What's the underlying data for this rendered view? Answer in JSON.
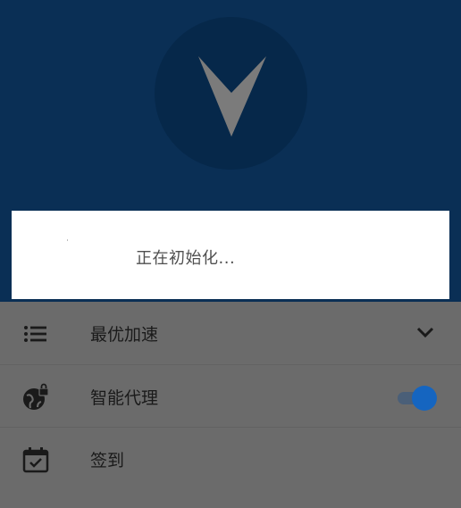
{
  "dialog": {
    "message": "正在初始化..."
  },
  "menu": {
    "items": [
      {
        "label": "最优加速",
        "icon": "list-icon",
        "control": "chevron-down-icon"
      },
      {
        "label": "智能代理",
        "icon": "globe-lock-icon",
        "control": "toggle",
        "toggle_on": true
      },
      {
        "label": "签到",
        "icon": "calendar-check-icon"
      }
    ]
  },
  "colors": {
    "header_bg": "#0a2f55",
    "logo_circle": "#06284a",
    "overlay": "#6b6b6b",
    "toggle_accent": "#1565c0"
  }
}
